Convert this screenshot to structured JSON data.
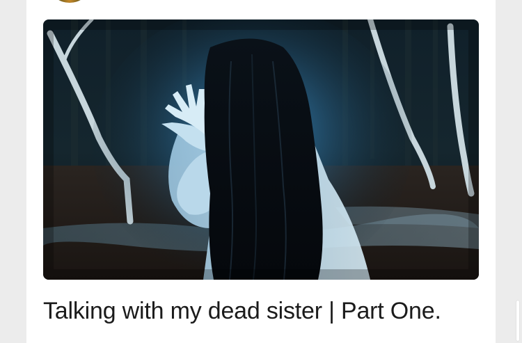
{
  "post": {
    "title": "Talking with my dead sister | Part One."
  },
  "colors": {
    "background": "#ececec",
    "card": "#ffffff",
    "title_text": "#1b1b1b"
  }
}
